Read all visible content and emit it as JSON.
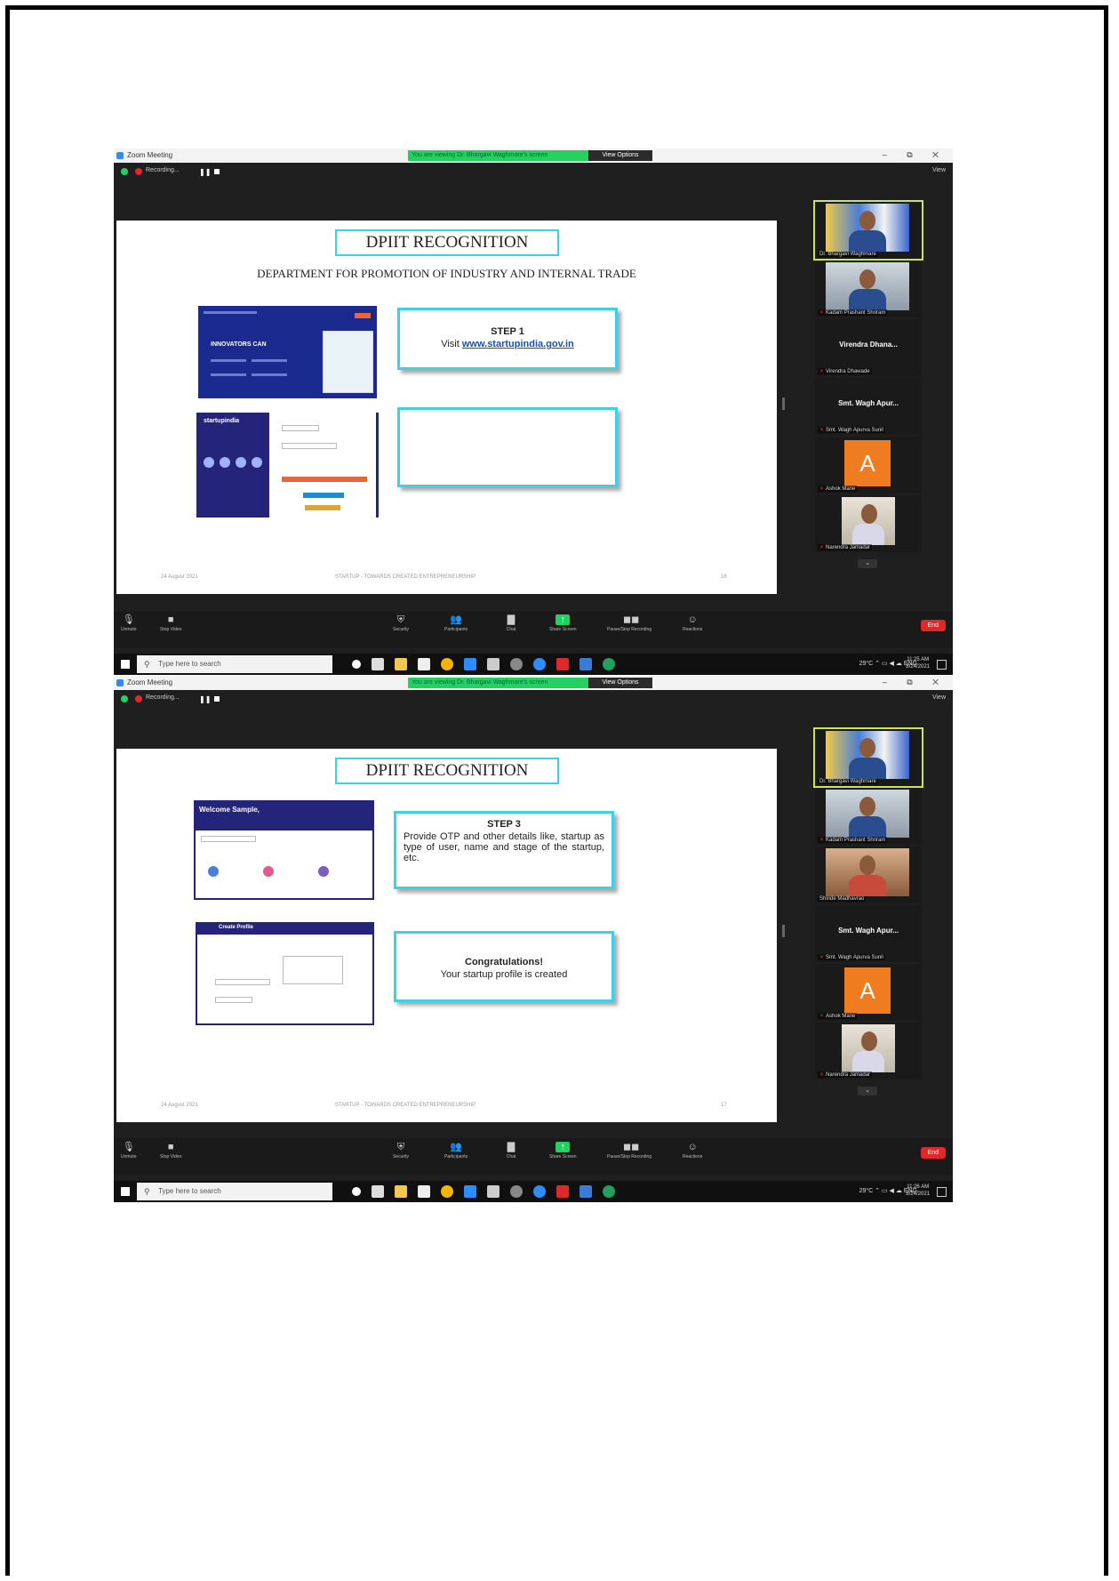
{
  "windows": [
    {
      "title": "Zoom Meeting",
      "share_banner": "You are viewing Dr. Bhargavi Waghmare's screen",
      "view_options": "View Options",
      "recording_label": "Recording...",
      "view_button": "View",
      "slide": {
        "title": "DPIIT RECOGNITION",
        "subtitle": "DEPARTMENT FOR PROMOTION OF INDUSTRY AND INTERNAL TRADE",
        "step_head": "STEP 1",
        "step_text": "Visit",
        "step_link": "www.startupindia.gov.in",
        "box2_text": "",
        "footer_date": "24 August 2021",
        "footer_center": "STARTUP - TOWARDS CREATED ENTREPRENEURSHIP",
        "footer_page": "16",
        "thumb1_head": "INNOVATORS CAN",
        "thumb2_head": "startupindia"
      },
      "participants": [
        {
          "name": "Dr. Bhargavi Waghmare",
          "big": ""
        },
        {
          "name": "Kadam Prashant Shriram",
          "big": ""
        },
        {
          "name": "Virendra Dhawade",
          "big": "Virendra Dhana..."
        },
        {
          "name": "Smt. Wagh Apurva Sunil",
          "big": "Smt. Wagh Apur..."
        },
        {
          "name": "Ashok Mane",
          "big": "A"
        },
        {
          "name": "Narendra Jamadar",
          "big": ""
        }
      ],
      "toolbar": {
        "unmute": "Unmute",
        "stop_video": "Stop Video",
        "security": "Security",
        "participants": "Participants",
        "participants_count": "15",
        "chat": "Chat",
        "share_screen": "Share Screen",
        "recording": "Pause/Stop Recording",
        "reactions": "Reactions",
        "end": "End"
      },
      "taskbar": {
        "search_placeholder": "Type here to search",
        "temperature": "29°C",
        "language": "ENG",
        "time": "11:25 AM",
        "date": "8/24/2021"
      }
    },
    {
      "title": "Zoom Meeting",
      "share_banner": "You are viewing Dr. Bhargavi Waghmare's screen",
      "view_options": "View Options",
      "recording_label": "Recording...",
      "view_button": "View",
      "slide": {
        "title": "DPIIT RECOGNITION",
        "step_head": "STEP 3",
        "step_text": "Provide OTP and other details like, startup as type of user, name and stage of the startup, etc.",
        "box2_head": "Congratulations!",
        "box2_text": "Your startup profile is created",
        "footer_date": "24 August 2021",
        "footer_center": "STARTUP - TOWARDS CREATED ENTREPRENEURSHIP",
        "footer_page": "17",
        "thumb1_head": "Welcome Sample,",
        "thumb2_head": "Create Profile"
      },
      "participants": [
        {
          "name": "Dr. Bhargavi Waghmare",
          "big": ""
        },
        {
          "name": "Kadam Prashant Shriram",
          "big": ""
        },
        {
          "name": "Shinde Madhavrao",
          "big": ""
        },
        {
          "name": "Smt. Wagh Apurva Sunil",
          "big": "Smt. Wagh Apur..."
        },
        {
          "name": "Ashok Mane",
          "big": "A"
        },
        {
          "name": "Narendra Jamadar",
          "big": ""
        }
      ],
      "toolbar": {
        "unmute": "Unmute",
        "stop_video": "Stop Video",
        "security": "Security",
        "participants": "Participants",
        "participants_count": "15",
        "chat": "Chat",
        "share_screen": "Share Screen",
        "recording": "Pause/Stop Recording",
        "reactions": "Reactions",
        "end": "End"
      },
      "taskbar": {
        "search_placeholder": "Type here to search",
        "temperature": "29°C",
        "language": "ENG",
        "time": "11:26 AM",
        "date": "8/24/2021"
      }
    }
  ],
  "colors": {
    "accent_cyan": "#3bd2e6",
    "zoom_green": "#23d160",
    "end_red": "#e02828",
    "avatar_orange": "#f07c22"
  }
}
